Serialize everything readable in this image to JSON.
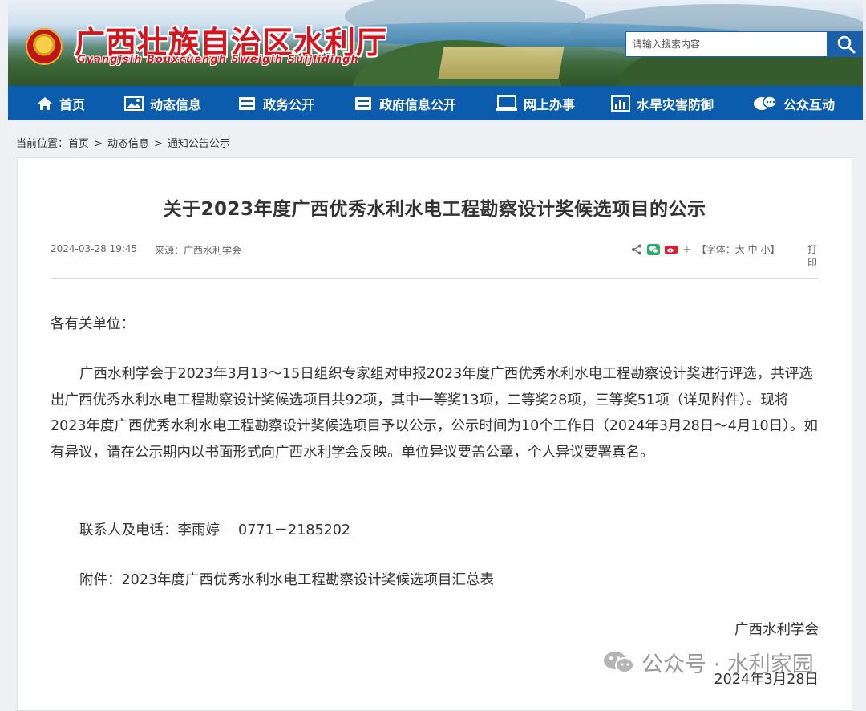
{
  "header": {
    "title": "广西壮族自治区水利厅",
    "subtitle": "Gvangjsih Bouxcuengh Sweigih Suijlidingh",
    "search_placeholder": "请输入搜索内容"
  },
  "nav": {
    "items": [
      {
        "label": "首页",
        "icon": "home-icon"
      },
      {
        "label": "动态信息",
        "icon": "image-icon"
      },
      {
        "label": "政务公开",
        "icon": "cabinet-icon"
      },
      {
        "label": "政府信息公开",
        "icon": "cabinet-icon"
      },
      {
        "label": "网上办事",
        "icon": "monitor-icon"
      },
      {
        "label": "水旱灾害防御",
        "icon": "bar-chart-icon"
      },
      {
        "label": "公众互动",
        "icon": "chat-icon"
      }
    ]
  },
  "breadcrumb": {
    "prefix": "当前位置：",
    "items": [
      "首页",
      "动态信息",
      "通知公告公示"
    ],
    "separator": ">"
  },
  "article": {
    "title": "关于2023年度广西优秀水利水电工程勘察设计奖候选项目的公示",
    "datetime": "2024-03-28 19:45",
    "source": "来源：广西水利学会",
    "font_label_open": "【字体：",
    "font_large": "大",
    "font_medium": "中",
    "font_small": "小",
    "font_label_close": "】",
    "print_label": "打印",
    "plus_sign": "+",
    "salutation": "各有关单位：",
    "paragraph": "广西水利学会于2023年3月13～15日组织专家组对申报2023年度广西优秀水利水电工程勘察设计奖进行评选，共评选出广西优秀水利水电工程勘察设计奖候选项目共92项，其中一等奖13项，二等奖28项，三等奖51项（详见附件）。现将2023年度广西优秀水利水电工程勘察设计奖候选项目予以公示，公示时间为10个工作日（2024年3月28日～4月10日）。如有异议，请在公示期内以书面形式向广西水利学会反映。单位异议要盖公章，个人异议要署真名。",
    "contact": "联系人及电话：李雨婷　 0771－2185202",
    "attachment": "附件：2023年度广西优秀水利水电工程勘察设计奖候选项目汇总表",
    "signature": "广西水利学会",
    "date": "2024年3月28日"
  },
  "watermark": {
    "text": "公众号 · 水利家园"
  },
  "colors": {
    "nav_bg": "#0b5cad",
    "title_red": "#d7131d",
    "page_bg": "#eef0f3"
  }
}
